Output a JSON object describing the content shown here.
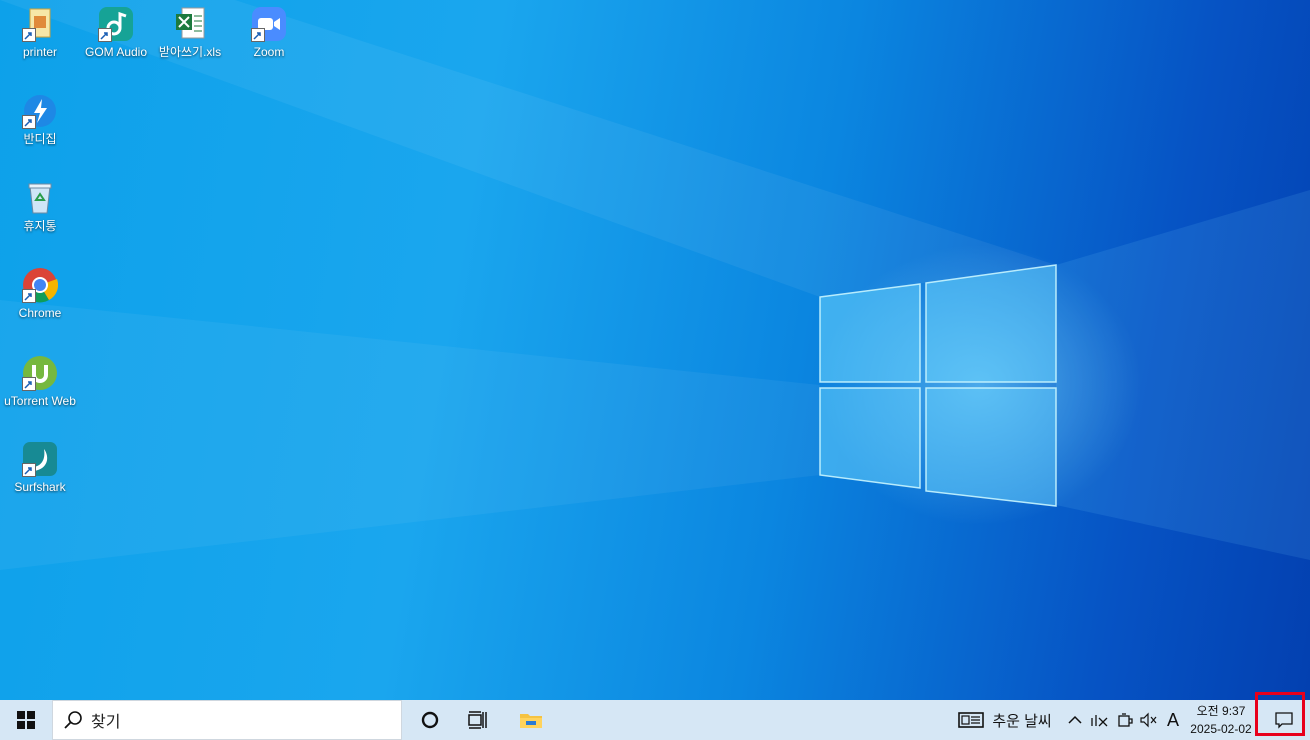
{
  "desktop": {
    "icons": [
      {
        "label": "printer"
      },
      {
        "label": "GOM Audio"
      },
      {
        "label": "받아쓰기.xls"
      },
      {
        "label": "Zoom"
      },
      {
        "label": "반디집"
      },
      {
        "label": "휴지통"
      },
      {
        "label": "Chrome"
      },
      {
        "label": "uTorrent Web"
      },
      {
        "label": "Surfshark"
      }
    ]
  },
  "taskbar": {
    "search_placeholder": "찾기",
    "weather_text": "추운 날씨",
    "ime_indicator": "A",
    "clock_time": "오전 9:37",
    "clock_date": "2025-02-02"
  },
  "colors": {
    "taskbar_bg": "#d6e7f5",
    "highlight_border": "#e8001c"
  }
}
